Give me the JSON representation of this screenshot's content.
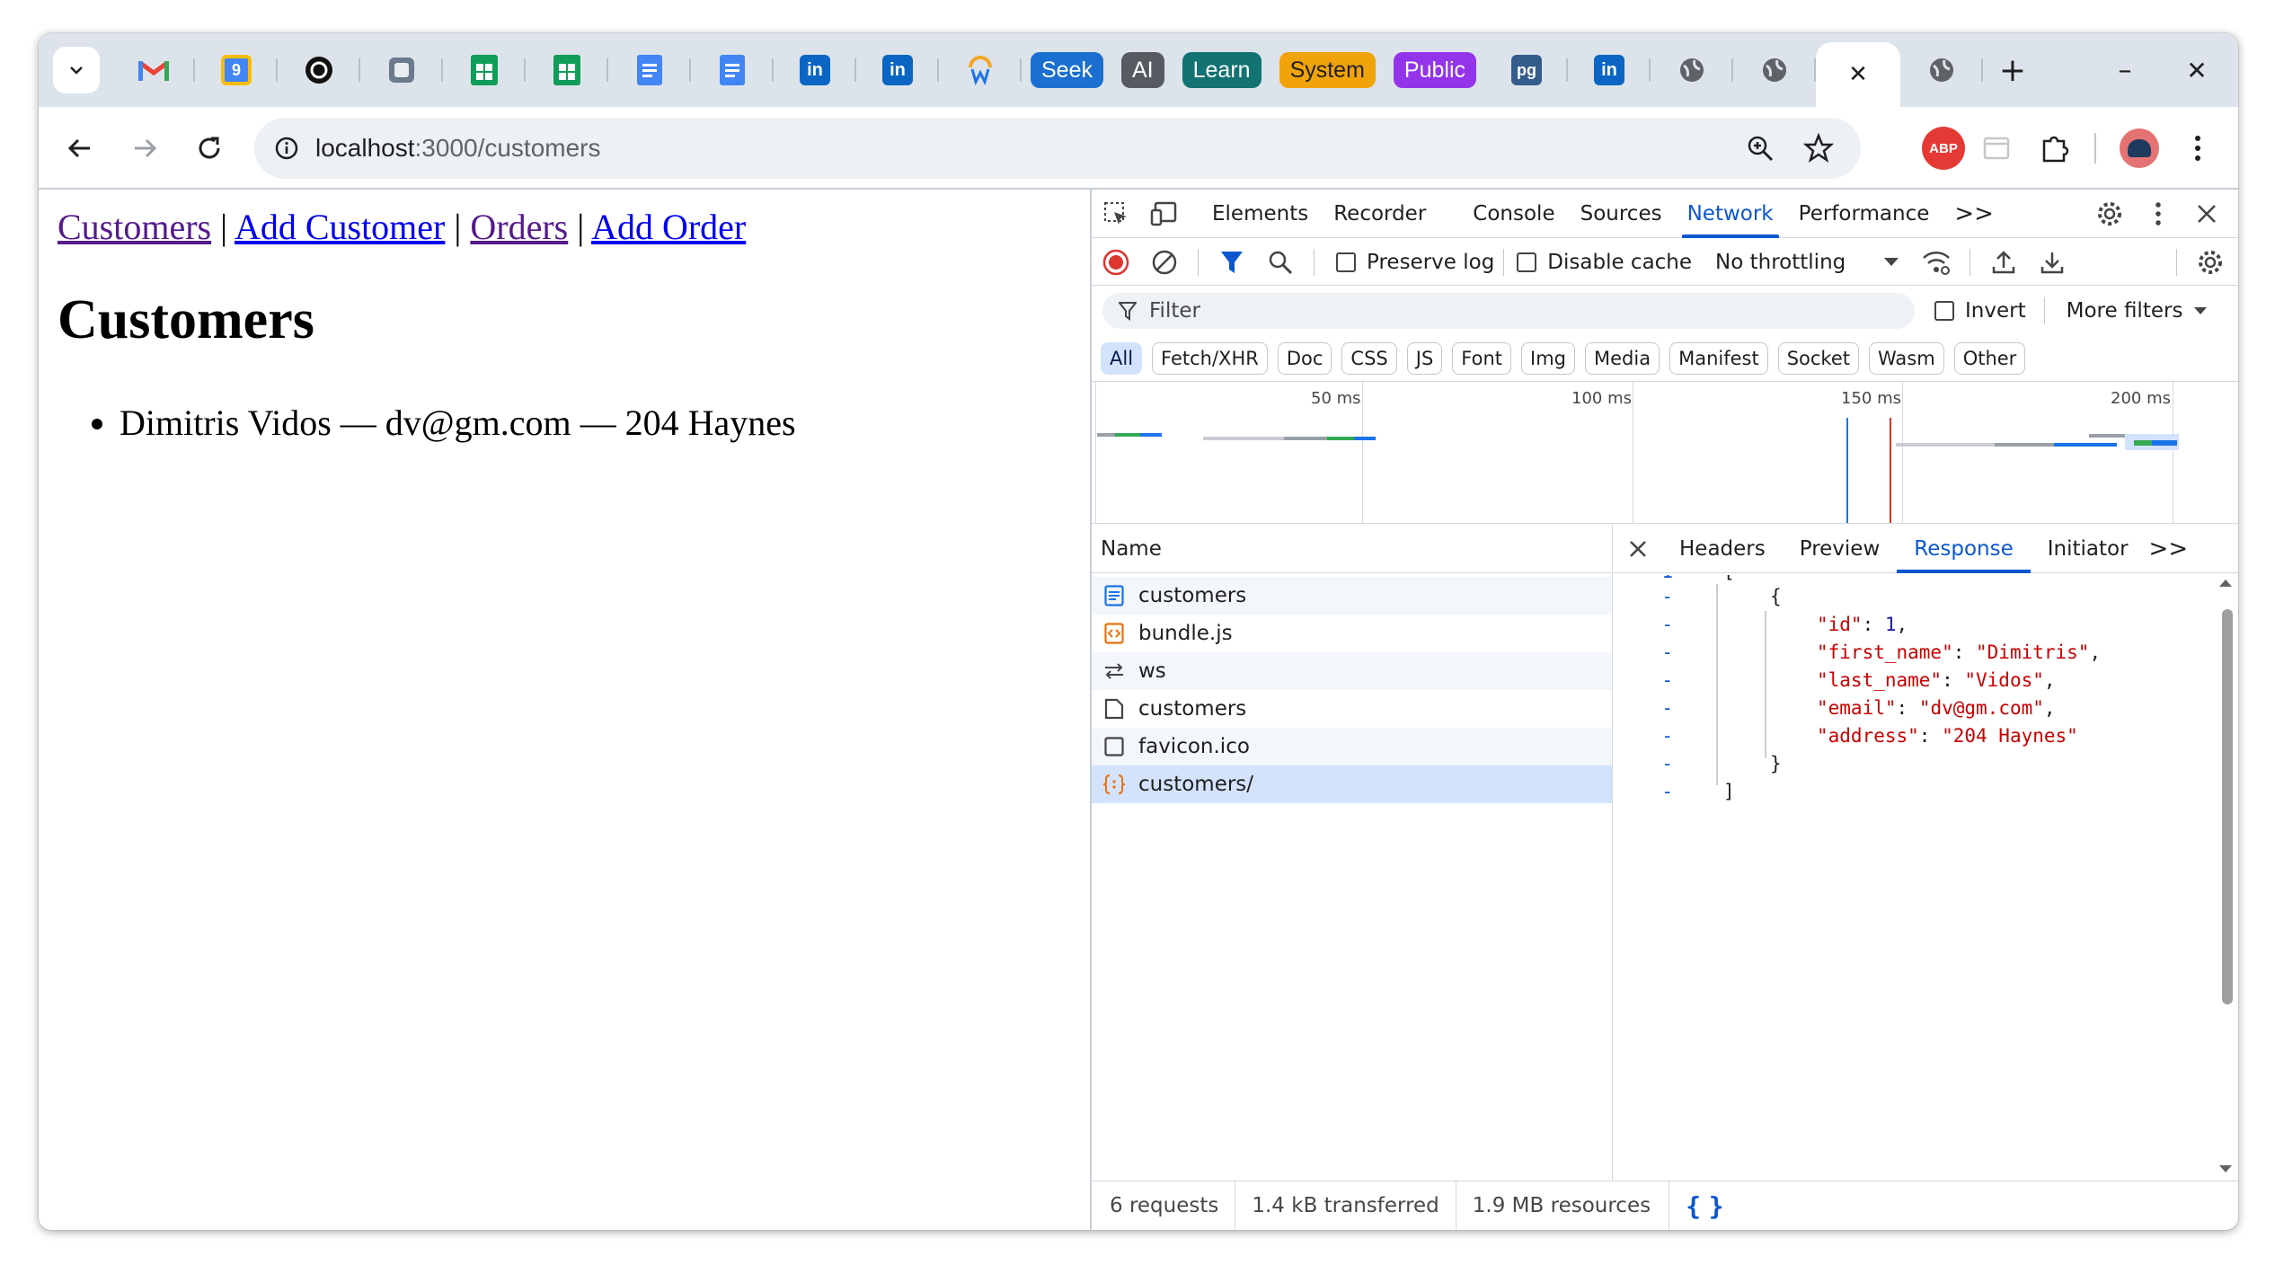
{
  "browser": {
    "tab_pills": [
      {
        "label": "Seek",
        "color": "#1a6fd0"
      },
      {
        "label": "AI",
        "color": "#555b61"
      },
      {
        "label": "Learn",
        "color": "#137272"
      },
      {
        "label": "System",
        "color": "#f0a30a"
      },
      {
        "label": "Public",
        "color": "#9333ea"
      }
    ],
    "active_tab_close": "✕",
    "new_tab": "+",
    "minimize": "–",
    "close_window": "✕",
    "url_host": "localhost",
    "url_path": ":3000/customers",
    "abp_label": "ABP"
  },
  "page": {
    "nav": {
      "customers": "Customers",
      "add_customer": "Add Customer",
      "orders": "Orders",
      "add_order": "Add Order",
      "separator": " | "
    },
    "heading": "Customers",
    "items": [
      "Dimitris Vidos — dv@gm.com — 204 Haynes"
    ]
  },
  "devtools": {
    "tabs": [
      "Elements",
      "Recorder",
      "Console",
      "Sources",
      "Network",
      "Performance"
    ],
    "active_tab": "Network",
    "more": ">>",
    "preserve_log": "Preserve log",
    "disable_cache": "Disable cache",
    "throttling": "No throttling",
    "filter_placeholder": "Filter",
    "invert": "Invert",
    "more_filters": "More filters",
    "chips": [
      "All",
      "Fetch/XHR",
      "Doc",
      "CSS",
      "JS",
      "Font",
      "Img",
      "Media",
      "Manifest",
      "Socket",
      "Wasm",
      "Other"
    ],
    "timeline_labels": [
      "50 ms",
      "100 ms",
      "150 ms",
      "200 ms"
    ],
    "name_header": "Name",
    "requests": [
      {
        "name": "customers",
        "icon": "document-icon"
      },
      {
        "name": "bundle.js",
        "icon": "script-icon"
      },
      {
        "name": "ws",
        "icon": "websocket-icon"
      },
      {
        "name": "customers",
        "icon": "file-icon"
      },
      {
        "name": "favicon.ico",
        "icon": "image-icon"
      },
      {
        "name": "customers/",
        "icon": "json-icon"
      }
    ],
    "detail_tabs": [
      "Headers",
      "Preview",
      "Response",
      "Initiator"
    ],
    "detail_active": "Response",
    "response": {
      "open_bracket": "[",
      "open_brace": "{",
      "fields": [
        {
          "key": "\"id\"",
          "value": "1",
          "trail": ","
        },
        {
          "key": "\"first_name\"",
          "value": "\"Dimitris\"",
          "trail": ","
        },
        {
          "key": "\"last_name\"",
          "value": "\"Vidos\"",
          "trail": ","
        },
        {
          "key": "\"email\"",
          "value": "\"dv@gm.com\"",
          "trail": ","
        },
        {
          "key": "\"address\"",
          "value": "\"204 Haynes\"",
          "trail": ""
        }
      ],
      "close_brace": "}",
      "close_bracket": "]",
      "gutter_marks": [
        "1",
        "-",
        "-",
        "-",
        "-",
        "-",
        "-",
        "-",
        "-"
      ]
    },
    "status": {
      "requests": "6 requests",
      "transferred": "1.4 kB transferred",
      "resources": "1.9 MB resources",
      "pretty_print": "{ }"
    }
  },
  "colors": {
    "accent": "#0b57d0",
    "tabstrip": "#dde3ea",
    "selected_row": "#d3e3fd"
  }
}
